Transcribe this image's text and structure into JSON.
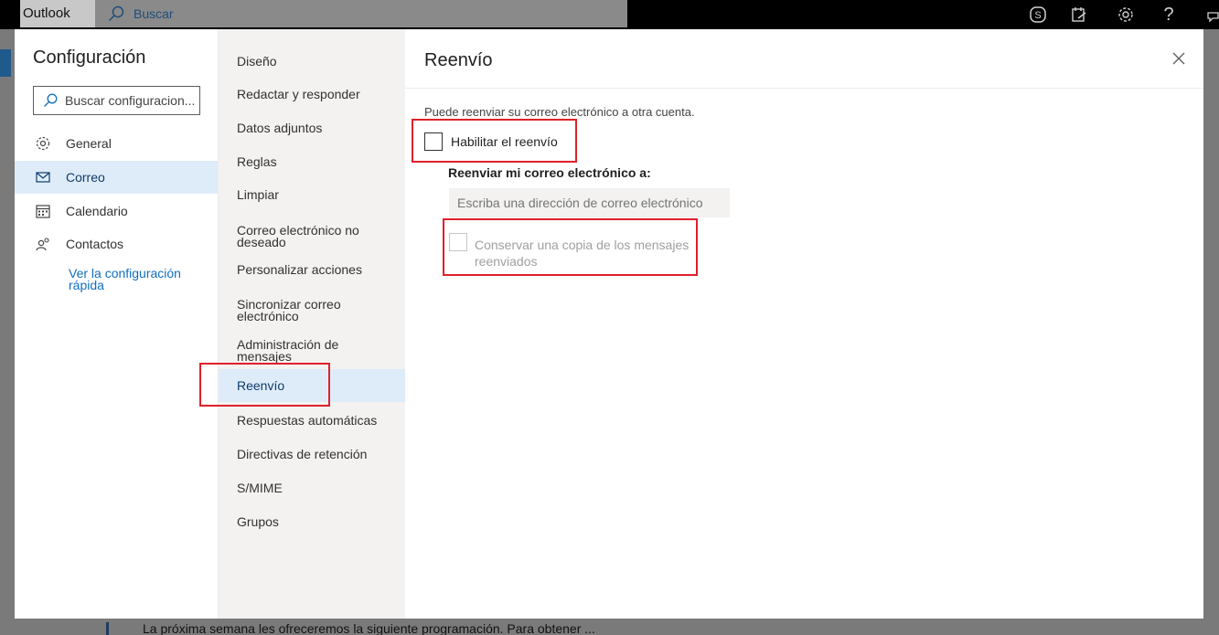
{
  "app": {
    "brand": "Outlook",
    "search_placeholder": "Buscar"
  },
  "topbar_icons": [
    "skype-icon",
    "whats-new-icon",
    "settings-icon",
    "help-icon",
    "feedback-icon"
  ],
  "settings": {
    "title": "Configuración",
    "search_placeholder": "Buscar configuracion...",
    "categories": [
      {
        "label": "General",
        "icon": "gear-icon"
      },
      {
        "label": "Correo",
        "icon": "mail-icon",
        "selected": true
      },
      {
        "label": "Calendario",
        "icon": "calendar-icon"
      },
      {
        "label": "Contactos",
        "icon": "people-icon"
      }
    ],
    "quick_settings_link": [
      "Ver la configuración",
      "rápida"
    ]
  },
  "mail_menu": {
    "items": [
      [
        "Diseño"
      ],
      [
        "Redactar y responder"
      ],
      [
        "Datos adjuntos"
      ],
      [
        "Reglas"
      ],
      [
        "Limpiar"
      ],
      [
        "Correo electrónico no",
        "deseado"
      ],
      [
        "Personalizar acciones"
      ],
      [
        "Sincronizar correo",
        "electrónico"
      ],
      [
        "Administración de",
        "mensajes"
      ],
      [
        "Reenvío"
      ],
      [
        "Respuestas automáticas"
      ],
      [
        "Directivas de retención"
      ],
      [
        "S/MIME"
      ],
      [
        "Grupos"
      ]
    ],
    "selected": "Reenvío"
  },
  "forwarding": {
    "title": "Reenvío",
    "intro": "Puede reenviar su correo electrónico a otra cuenta.",
    "enable_label": "Habilitar el reenvío",
    "enable_checked": false,
    "forward_to_label": "Reenviar mi correo electrónico a:",
    "email_placeholder": "Escriba una dirección de correo electrónico",
    "keep_copy_label": "Conservar una copia de los mensajes reenviados",
    "keep_copy_checked": false,
    "keep_copy_disabled": true
  },
  "background": {
    "bottom_text": "La próxima semana les ofreceremos la siguiente programación. Para obtener ..."
  },
  "colors": {
    "highlight": "#e0202a",
    "selected_bg": "#deecf9",
    "link": "#106ebe"
  }
}
